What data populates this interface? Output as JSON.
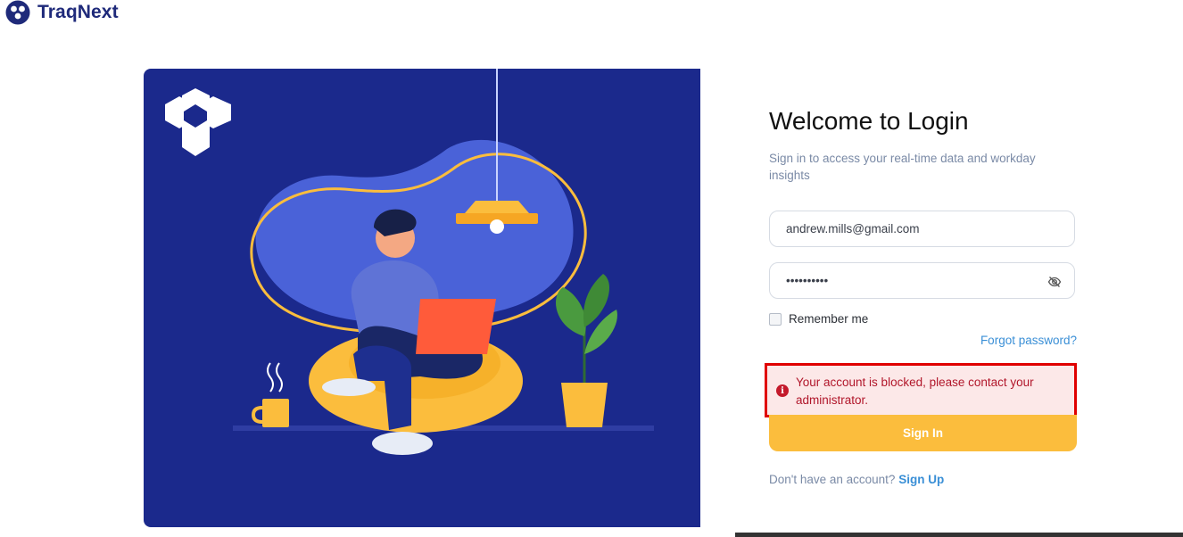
{
  "brand": {
    "name": "TraqNext"
  },
  "login": {
    "title": "Welcome to Login",
    "subtitle": "Sign in to access your real-time data and workday insights",
    "email_value": "andrew.mills@gmail.com",
    "password_value": "••••••••••",
    "remember_label": "Remember me",
    "forgot_label": "Forgot password?",
    "error_message": "Your account is blocked, please contact your administrator.",
    "error_icon": "info-icon",
    "signin_label": "Sign In",
    "signup_prompt": "Don't have an account?",
    "signup_label": "Sign Up"
  },
  "colors": {
    "illustration_bg": "#1b298c",
    "accent_yellow": "#fbbd3d",
    "error_red": "#e00000",
    "link_blue": "#3a8fd6"
  }
}
